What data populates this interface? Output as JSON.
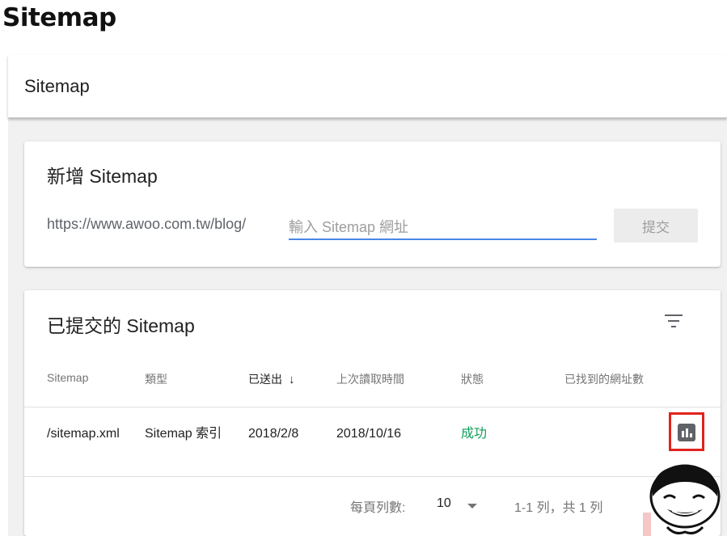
{
  "page_heading": "Sitemap",
  "topbar": {
    "title": "Sitemap"
  },
  "add_card": {
    "title": "新增 Sitemap",
    "url_prefix": "https://www.awoo.com.tw/blog/",
    "input_placeholder": "輸入 Sitemap 網址",
    "submit_label": "提交"
  },
  "list_card": {
    "title": "已提交的 Sitemap",
    "filter_icon": "filter-icon",
    "columns": [
      "Sitemap",
      "類型",
      "已送出",
      "上次讀取時間",
      "狀態",
      "已找到的網址數"
    ],
    "sorted_column": "已送出",
    "sort_direction_icon": "arrow-down-icon",
    "rows": [
      {
        "sitemap": "/sitemap.xml",
        "type": "Sitemap 索引",
        "submitted": "2018/2/8",
        "last_read": "2018/10/16",
        "status": "成功",
        "urls_found": "",
        "action_icon": "bar-chart-icon"
      }
    ],
    "footer": {
      "rows_per_page_label": "每頁列數:",
      "rows_per_page_value": "10",
      "range_text": "1-1 列，共 1 列"
    }
  },
  "colors": {
    "accent": "#4a86e8",
    "success": "#0f9d58",
    "highlight_border": "#e0231c"
  }
}
